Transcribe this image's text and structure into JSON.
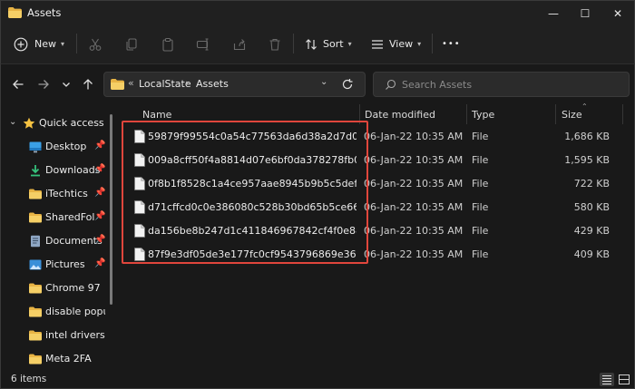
{
  "window": {
    "title": "Assets",
    "minimize_glyph": "—",
    "maximize_glyph": "☐",
    "close_glyph": "✕"
  },
  "commandbar": {
    "new_label": "New",
    "sort_label": "Sort",
    "view_label": "View",
    "more_glyph": "•••"
  },
  "address": {
    "overflow": "«",
    "parts": [
      "LocalState",
      "Assets"
    ]
  },
  "search": {
    "placeholder": "Search Assets"
  },
  "sidebar": {
    "items": [
      {
        "label": "Quick access",
        "icon": "star-icon"
      },
      {
        "label": "Desktop",
        "icon": "desktop-icon"
      },
      {
        "label": "Downloads",
        "icon": "download-icon"
      },
      {
        "label": "iTechtics",
        "icon": "folder-icon"
      },
      {
        "label": "SharedFolde",
        "icon": "folder-icon"
      },
      {
        "label": "Documents",
        "icon": "document-icon"
      },
      {
        "label": "Pictures",
        "icon": "pictures-icon"
      },
      {
        "label": "Chrome 97",
        "icon": "folder-icon"
      },
      {
        "label": "disable popup",
        "icon": "folder-icon"
      },
      {
        "label": "intel drivers",
        "icon": "folder-icon"
      },
      {
        "label": "Meta 2FA",
        "icon": "folder-icon"
      }
    ]
  },
  "columns": {
    "name": "Name",
    "date": "Date modified",
    "type": "Type",
    "size": "Size"
  },
  "files": [
    {
      "name": "59879f99554c0a54c77563da6d38a2d7d0e42e7cd9f9...",
      "date": "06-Jan-22 10:35 AM",
      "type": "File",
      "size": "1,686 KB"
    },
    {
      "name": "009a8cff50f4a8814d07e6bf0da378278fb04045d93f1f...",
      "date": "06-Jan-22 10:35 AM",
      "type": "File",
      "size": "1,595 KB"
    },
    {
      "name": "0f8b1f8528c1a4ce957aae8945b9b5c5defc536988aca...",
      "date": "06-Jan-22 10:35 AM",
      "type": "File",
      "size": "722 KB"
    },
    {
      "name": "d71cffcd0c0e386080c528b30bd65b5ce663c88c89e0...",
      "date": "06-Jan-22 10:35 AM",
      "type": "File",
      "size": "580 KB"
    },
    {
      "name": "da156be8b247d1c411846967842cf4f0e881dbe8a5d2...",
      "date": "06-Jan-22 10:35 AM",
      "type": "File",
      "size": "429 KB"
    },
    {
      "name": "87f9e3df05de3e177fc0cf9543796869e367483481354...",
      "date": "06-Jan-22 10:35 AM",
      "type": "File",
      "size": "409 KB"
    }
  ],
  "status": {
    "items_text": "6 items"
  },
  "colors": {
    "accent": "#4cc2ff",
    "folder": "#f0c05a",
    "highlight": "#e0463c"
  }
}
